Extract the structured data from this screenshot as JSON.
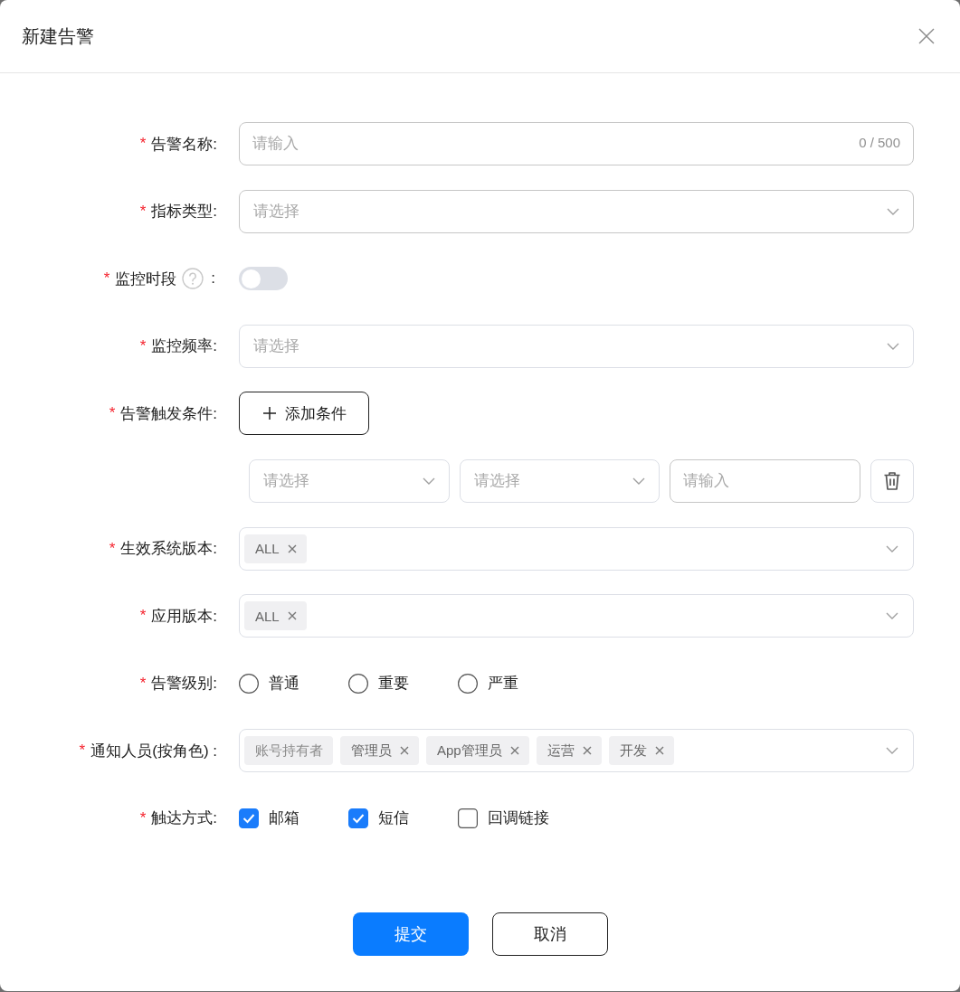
{
  "dialog": {
    "title": "新建告警"
  },
  "form": {
    "fields": [
      {
        "kind": "text",
        "required_mark": "*",
        "label": "告警名称:",
        "placeholder": "请输入",
        "counter": "0 / 500"
      },
      {
        "kind": "select",
        "required_mark": "*",
        "label": "指标类型:",
        "placeholder": "请选择"
      },
      {
        "kind": "switch",
        "required_mark": "*",
        "label": "监控时段",
        "help": true,
        "label_suffix": ":",
        "on": false
      },
      {
        "kind": "select",
        "required_mark": "*",
        "label": "监控频率:",
        "placeholder": "请选择"
      },
      {
        "kind": "add_button",
        "required_mark": "*",
        "label": "告警触发条件:",
        "button": "添加条件",
        "conditions": [
          {
            "inputs": [
              {
                "kind": "select",
                "placeholder": "请选择"
              },
              {
                "kind": "select",
                "placeholder": "请选择"
              },
              {
                "kind": "text",
                "placeholder": "请输入"
              }
            ]
          }
        ]
      },
      {
        "kind": "tags",
        "required_mark": "*",
        "label": "生效系统版本:",
        "tags": [
          {
            "text": "ALL",
            "closable": true
          }
        ]
      },
      {
        "kind": "tags",
        "required_mark": "*",
        "label": "应用版本:",
        "tags": [
          {
            "text": "ALL",
            "closable": true
          }
        ]
      },
      {
        "kind": "radio",
        "required_mark": "*",
        "label": "告警级别:",
        "options": [
          {
            "label": "普通",
            "selected": false
          },
          {
            "label": "重要",
            "selected": false
          },
          {
            "label": "严重",
            "selected": false
          }
        ]
      },
      {
        "kind": "tags",
        "required_mark": "*",
        "label": "通知人员(按角色) :",
        "tags": [
          {
            "text": "账号持有者",
            "closable": false
          },
          {
            "text": "管理员",
            "closable": true
          },
          {
            "text": "App管理员",
            "closable": true
          },
          {
            "text": "运营",
            "closable": true
          },
          {
            "text": "开发",
            "closable": true
          }
        ]
      },
      {
        "kind": "checkbox",
        "required_mark": "*",
        "label": "触达方式:",
        "options": [
          {
            "label": "邮箱",
            "checked": true
          },
          {
            "label": "短信",
            "checked": true
          },
          {
            "label": "回调链接",
            "checked": false
          }
        ]
      }
    ]
  },
  "footer": {
    "buttons": [
      {
        "label": "提交",
        "kind": "primary"
      },
      {
        "label": "取消",
        "kind": "default"
      }
    ]
  }
}
